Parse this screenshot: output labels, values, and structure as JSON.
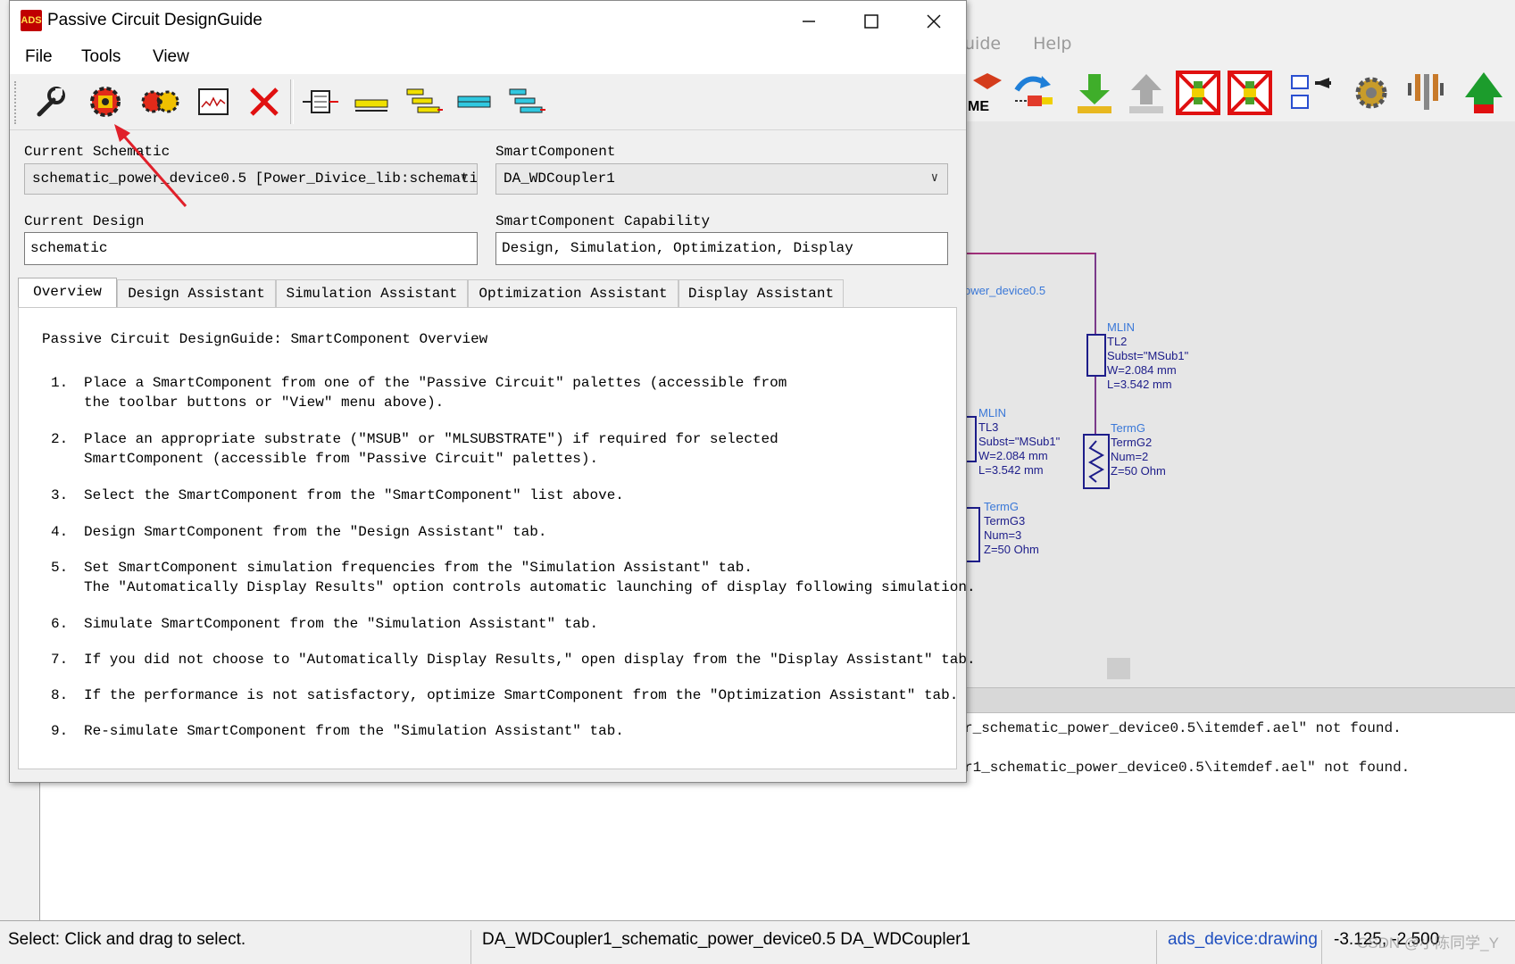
{
  "background_app": {
    "menu": [
      "uide",
      "Help"
    ],
    "schematic": {
      "net_label": "ower_device0.5",
      "tl2": {
        "type": "MLIN",
        "name": "TL2",
        "subst": "Subst=\"MSub1\"",
        "w": "W=2.084 mm",
        "l": "L=3.542 mm"
      },
      "tl3": {
        "type": "MLIN",
        "name": "TL3",
        "subst": "Subst=\"MSub1\"",
        "w": "W=2.084 mm",
        "l": "L=3.542 mm"
      },
      "termg2": {
        "type": "TermG",
        "name": "TermG2",
        "num": "Num=2",
        "z": "Z=50 Ohm"
      },
      "termg3": {
        "type": "TermG",
        "name": "TermG3",
        "num": "Num=3",
        "z": "Z=50 Ohm"
      },
      "toolbar_text": "ME"
    },
    "messages": [
      "r_schematic_power_device0.5\\itemdef.ael\" not found.",
      "r1_schematic_power_device0.5\\itemdef.ael\" not found."
    ],
    "status": {
      "hint": "Select: Click and drag to select.",
      "design": "DA_WDCoupler1_schematic_power_device0.5 DA_WDCoupler1",
      "view": "ads_device:drawing",
      "coords": "-3.125, -2.500",
      "watermark": "CSDN @小陈同学_Y"
    }
  },
  "dialog": {
    "title": "Passive Circuit DesignGuide",
    "app_icon_text": "ADS",
    "menu": {
      "file": "File",
      "tools": "Tools",
      "view": "View"
    },
    "toolbar_icons": [
      "wrench-icon",
      "smart-component-icon",
      "multi-component-icon",
      "display-graph-icon",
      "delete-icon",
      "align-center-icon",
      "bar-single-icon",
      "bar-stack-icon",
      "bar-cyan-icon",
      "bar-cascade-icon"
    ],
    "current_schematic_label": "Current Schematic",
    "current_schematic_value": "schematic_power_device0.5 [Power_Divice_lib:schemati",
    "smart_component_label": "SmartComponent",
    "smart_component_value": "DA_WDCoupler1",
    "current_design_label": "Current Design",
    "current_design_value": "schematic",
    "capability_label": "SmartComponent Capability",
    "capability_value": "Design, Simulation, Optimization, Display",
    "tabs": [
      "Overview",
      "Design Assistant",
      "Simulation Assistant",
      "Optimization Assistant",
      "Display Assistant"
    ],
    "active_tab": "Overview",
    "overview_title": "Passive Circuit DesignGuide: SmartComponent Overview",
    "steps": [
      {
        "n": "1.",
        "lines": [
          "Place a SmartComponent from one of the \"Passive Circuit\" palettes (accessible from",
          "the toolbar buttons or \"View\" menu above)."
        ]
      },
      {
        "n": "2.",
        "lines": [
          "Place an appropriate substrate (\"MSUB\" or \"MLSUBSTRATE\") if required for selected",
          "SmartComponent (accessible from \"Passive Circuit\" palettes)."
        ]
      },
      {
        "n": "3.",
        "lines": [
          "Select the SmartComponent from the \"SmartComponent\" list above."
        ]
      },
      {
        "n": "4.",
        "lines": [
          "Design SmartComponent from the \"Design Assistant\" tab."
        ]
      },
      {
        "n": "5.",
        "lines": [
          "Set SmartComponent simulation frequencies from the \"Simulation Assistant\" tab.",
          "The \"Automatically Display Results\" option controls automatic launching of display following simulation."
        ]
      },
      {
        "n": "6.",
        "lines": [
          "Simulate SmartComponent from the \"Simulation Assistant\" tab."
        ]
      },
      {
        "n": "7.",
        "lines": [
          "If you did not choose to \"Automatically Display Results,\" open display from the \"Display Assistant\" tab."
        ]
      },
      {
        "n": "8.",
        "lines": [
          "If the performance is not satisfactory, optimize SmartComponent from the \"Optimization Assistant\" tab."
        ]
      },
      {
        "n": "9.",
        "lines": [
          "Re-simulate SmartComponent from the \"Simulation Assistant\" tab."
        ]
      }
    ]
  },
  "colors": {
    "annotation_arrow": "#e0202a",
    "accent_link": "#1f4fbf"
  }
}
